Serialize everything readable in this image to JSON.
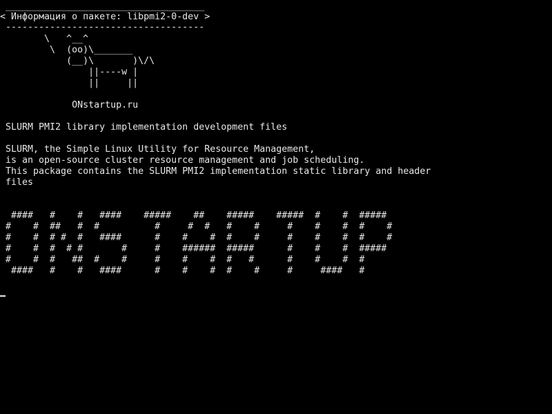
{
  "bubble": {
    "top_border": " ____________________________________",
    "text": "< Информация о пакете: libpmi2-0-dev >",
    "bottom_border": " ------------------------------------"
  },
  "cow": {
    "line1": "        \\   ^__^",
    "line2": "         \\  (oo)\\_______",
    "line3": "            (__)\\       )\\/\\",
    "line4": "                ||----w |",
    "line5": "                ||     ||"
  },
  "site_label": "             ONstartup.ru",
  "summary": " SLURM PMI2 library implementation development files",
  "description": {
    "line1": " SLURM, the Simple Linux Utility for Resource Management,",
    "line2": " is an open-source cluster resource management and job scheduling.",
    "line3": " This package contains the SLURM PMI2 implementation static library and header",
    "line4": " files"
  },
  "banner": {
    "line1": "  ####   #    #   ####    #####    ##    #####    #####  #    #  #####",
    "line2": " #    #  ##   #  #          #     #  #   #    #     #    #    #  #    #",
    "line3": " #    #  # #  #   ####      #    #    #  #    #     #    #    #  #    #",
    "line4": " #    #  #  # #       #     #    ######  #####      #    #    #  #####",
    "line5": " #    #  #   ##  #    #     #    #    #  #   #      #    #    #  #",
    "line6": "  ####   #    #   ####      #    #    #  #    #     #     ####   #"
  }
}
